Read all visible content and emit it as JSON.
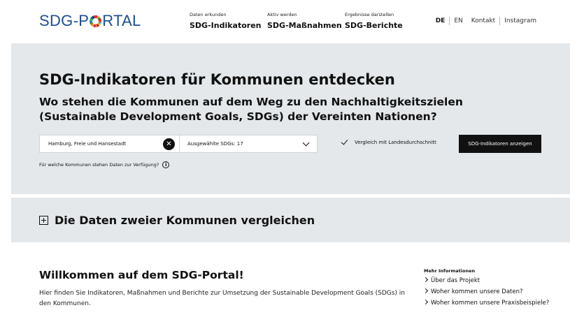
{
  "header": {
    "logo_left": "SDG-P",
    "logo_right": "RTAL",
    "nav": [
      {
        "small": "Daten erkunden",
        "label": "SDG-Indikatoren"
      },
      {
        "small": "Aktiv werden",
        "label": "SDG-Maßnahmen"
      },
      {
        "small": "Ergebnisse darstellen",
        "label": "SDG-Berichte"
      }
    ],
    "lang_de": "DE",
    "lang_en": "EN",
    "contact": "Kontakt",
    "instagram": "Instagram"
  },
  "hero": {
    "title": "SDG-Indikatoren für Kommunen entdecken",
    "subtitle": "Wo stehen die Kommunen auf dem Weg zu den Nachhaltigkeitszielen (Sustainable Development Goals, SDGs) der Vereinten Nationen?",
    "city_value": "Hamburg, Freie und Hansestadt",
    "sdg_select": "Ausgewählte SDGs: 17",
    "compare_label": "Vergleich mit Landesdurchschnitt",
    "show_button": "SDG-Indikatoren anzeigen",
    "help_text": "Für welche Kommunen stehen Daten zur Verfügung?"
  },
  "compare_band": {
    "title": "Die Daten zweier Kommunen vergleichen"
  },
  "welcome": {
    "title": "Willkommen auf dem SDG-Portal!",
    "text": "Hier finden Sie Indikatoren, Maßnahmen und Berichte zur Umsetzung der Sustainable Development Goals (SDGs) in den Kommunen."
  },
  "more_info": {
    "title": "Mehr Informationen",
    "links": [
      "Über das Projekt",
      "Woher kommen unsere Daten?",
      "Woher kommen unsere Praxisbeispiele?"
    ]
  },
  "colors": {
    "brand": "#1d4f8f",
    "hero_bg": "#e4e8eb",
    "button_bg": "#111111"
  }
}
